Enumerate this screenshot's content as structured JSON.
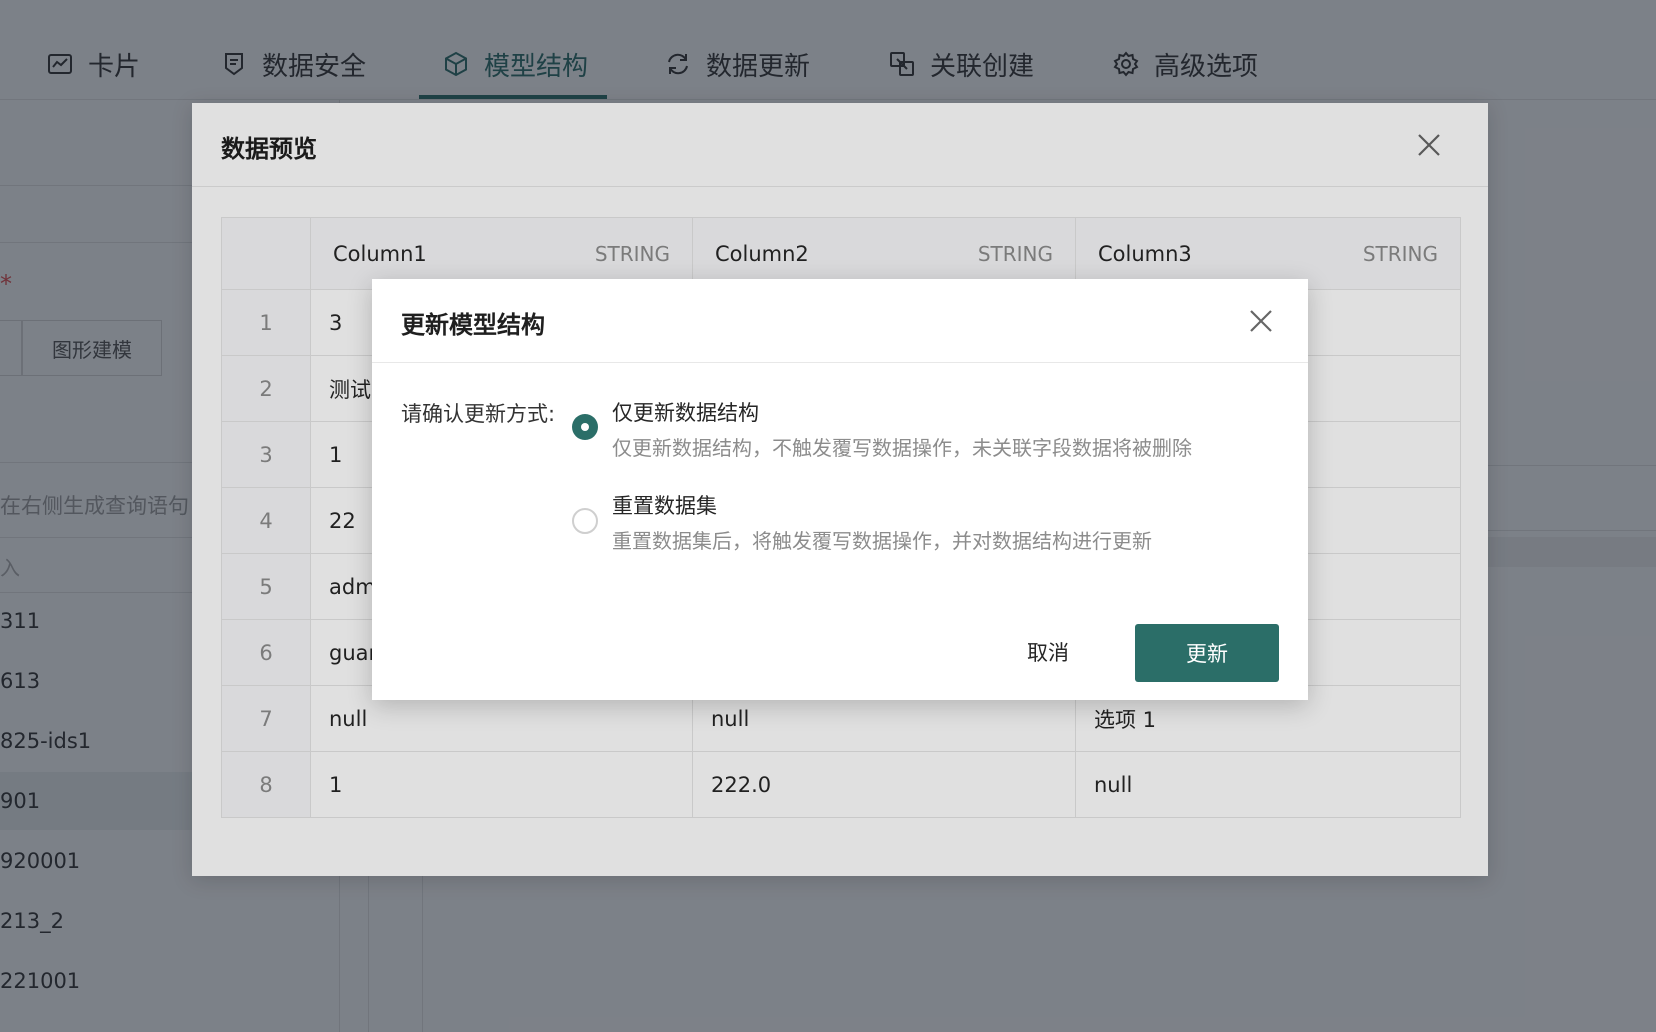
{
  "tabs": [
    {
      "label": "卡片",
      "icon": "chart-card-icon"
    },
    {
      "label": "数据安全",
      "icon": "shield-icon"
    },
    {
      "label": "模型结构",
      "icon": "cube-icon",
      "active": true
    },
    {
      "label": "数据更新",
      "icon": "refresh-icon"
    },
    {
      "label": "关联创建",
      "icon": "link-create-icon"
    },
    {
      "label": "高级选项",
      "icon": "gear-icon"
    }
  ],
  "background": {
    "required_mark": "*",
    "modeling_button": "图形建模",
    "query_hint": "在右侧生成查询语句",
    "search_fragment": "入",
    "dataset_items": [
      "311",
      "613",
      "825-ids1",
      "901",
      "920001",
      "213_2",
      "221001"
    ]
  },
  "preview": {
    "title": "数据预览",
    "columns": [
      {
        "name": "Column1",
        "type": "STRING"
      },
      {
        "name": "Column2",
        "type": "STRING"
      },
      {
        "name": "Column3",
        "type": "STRING"
      }
    ],
    "rows": [
      {
        "index": "1",
        "cells": [
          "3",
          "",
          ""
        ]
      },
      {
        "index": "2",
        "cells": [
          "测试",
          "",
          ""
        ]
      },
      {
        "index": "3",
        "cells": [
          "1",
          "",
          ""
        ]
      },
      {
        "index": "4",
        "cells": [
          "22",
          "",
          ""
        ]
      },
      {
        "index": "5",
        "cells": [
          "adm",
          "",
          ""
        ]
      },
      {
        "index": "6",
        "cells": [
          "guar",
          "",
          ""
        ]
      },
      {
        "index": "7",
        "cells": [
          "null",
          "null",
          "选项 1"
        ]
      },
      {
        "index": "8",
        "cells": [
          "1",
          "222.0",
          "null"
        ]
      }
    ]
  },
  "dialog": {
    "title": "更新模型结构",
    "confirm_label": "请确认更新方式:",
    "options": [
      {
        "title": "仅更新数据结构",
        "desc": "仅更新数据结构，不触发覆写数据操作，未关联字段数据将被删除",
        "selected": true
      },
      {
        "title": "重置数据集",
        "desc": "重置数据集后，将触发覆写数据操作，并对数据结构进行更新",
        "selected": false
      }
    ],
    "cancel_label": "取消",
    "confirm_button": "更新"
  },
  "colors": {
    "accent": "#2b6e68",
    "danger": "#e34d4d"
  }
}
